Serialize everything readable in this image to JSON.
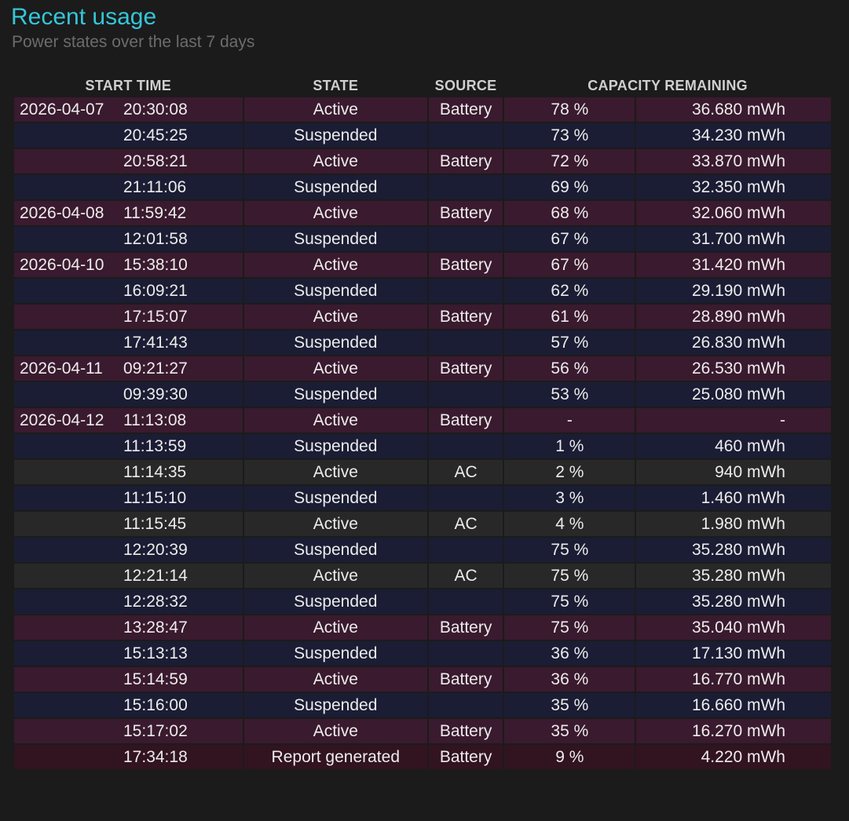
{
  "header": {
    "title": "Recent usage",
    "subtitle": "Power states over the last 7 days"
  },
  "columns": {
    "start_time": "START TIME",
    "state": "STATE",
    "source": "SOURCE",
    "capacity_remaining": "CAPACITY REMAINING"
  },
  "rows": [
    {
      "date": "2026-04-07",
      "time": "20:30:08",
      "state": "Active",
      "source": "Battery",
      "pct": "78 %",
      "mwh": "36.680 mWh",
      "kind": "battery"
    },
    {
      "date": "",
      "time": "20:45:25",
      "state": "Suspended",
      "source": "",
      "pct": "73 %",
      "mwh": "34.230 mWh",
      "kind": "suspended"
    },
    {
      "date": "",
      "time": "20:58:21",
      "state": "Active",
      "source": "Battery",
      "pct": "72 %",
      "mwh": "33.870 mWh",
      "kind": "battery"
    },
    {
      "date": "",
      "time": "21:11:06",
      "state": "Suspended",
      "source": "",
      "pct": "69 %",
      "mwh": "32.350 mWh",
      "kind": "suspended"
    },
    {
      "date": "2026-04-08",
      "time": "11:59:42",
      "state": "Active",
      "source": "Battery",
      "pct": "68 %",
      "mwh": "32.060 mWh",
      "kind": "battery"
    },
    {
      "date": "",
      "time": "12:01:58",
      "state": "Suspended",
      "source": "",
      "pct": "67 %",
      "mwh": "31.700 mWh",
      "kind": "suspended"
    },
    {
      "date": "2026-04-10",
      "time": "15:38:10",
      "state": "Active",
      "source": "Battery",
      "pct": "67 %",
      "mwh": "31.420 mWh",
      "kind": "battery"
    },
    {
      "date": "",
      "time": "16:09:21",
      "state": "Suspended",
      "source": "",
      "pct": "62 %",
      "mwh": "29.190 mWh",
      "kind": "suspended"
    },
    {
      "date": "",
      "time": "17:15:07",
      "state": "Active",
      "source": "Battery",
      "pct": "61 %",
      "mwh": "28.890 mWh",
      "kind": "battery"
    },
    {
      "date": "",
      "time": "17:41:43",
      "state": "Suspended",
      "source": "",
      "pct": "57 %",
      "mwh": "26.830 mWh",
      "kind": "suspended"
    },
    {
      "date": "2026-04-11",
      "time": "09:21:27",
      "state": "Active",
      "source": "Battery",
      "pct": "56 %",
      "mwh": "26.530 mWh",
      "kind": "battery"
    },
    {
      "date": "",
      "time": "09:39:30",
      "state": "Suspended",
      "source": "",
      "pct": "53 %",
      "mwh": "25.080 mWh",
      "kind": "suspended"
    },
    {
      "date": "2026-04-12",
      "time": "11:13:08",
      "state": "Active",
      "source": "Battery",
      "pct": "-",
      "mwh": "-",
      "kind": "battery"
    },
    {
      "date": "",
      "time": "11:13:59",
      "state": "Suspended",
      "source": "",
      "pct": "1 %",
      "mwh": "460 mWh",
      "kind": "suspended"
    },
    {
      "date": "",
      "time": "11:14:35",
      "state": "Active",
      "source": "AC",
      "pct": "2 %",
      "mwh": "940 mWh",
      "kind": "ac"
    },
    {
      "date": "",
      "time": "11:15:10",
      "state": "Suspended",
      "source": "",
      "pct": "3 %",
      "mwh": "1.460 mWh",
      "kind": "suspended"
    },
    {
      "date": "",
      "time": "11:15:45",
      "state": "Active",
      "source": "AC",
      "pct": "4 %",
      "mwh": "1.980 mWh",
      "kind": "ac"
    },
    {
      "date": "",
      "time": "12:20:39",
      "state": "Suspended",
      "source": "",
      "pct": "75 %",
      "mwh": "35.280 mWh",
      "kind": "suspended"
    },
    {
      "date": "",
      "time": "12:21:14",
      "state": "Active",
      "source": "AC",
      "pct": "75 %",
      "mwh": "35.280 mWh",
      "kind": "ac"
    },
    {
      "date": "",
      "time": "12:28:32",
      "state": "Suspended",
      "source": "",
      "pct": "75 %",
      "mwh": "35.280 mWh",
      "kind": "suspended"
    },
    {
      "date": "",
      "time": "13:28:47",
      "state": "Active",
      "source": "Battery",
      "pct": "75 %",
      "mwh": "35.040 mWh",
      "kind": "battery"
    },
    {
      "date": "",
      "time": "15:13:13",
      "state": "Suspended",
      "source": "",
      "pct": "36 %",
      "mwh": "17.130 mWh",
      "kind": "suspended"
    },
    {
      "date": "",
      "time": "15:14:59",
      "state": "Active",
      "source": "Battery",
      "pct": "36 %",
      "mwh": "16.770 mWh",
      "kind": "battery"
    },
    {
      "date": "",
      "time": "15:16:00",
      "state": "Suspended",
      "source": "",
      "pct": "35 %",
      "mwh": "16.660 mWh",
      "kind": "suspended"
    },
    {
      "date": "",
      "time": "15:17:02",
      "state": "Active",
      "source": "Battery",
      "pct": "35 %",
      "mwh": "16.270 mWh",
      "kind": "battery"
    },
    {
      "date": "",
      "time": "17:34:18",
      "state": "Report generated",
      "source": "Battery",
      "pct": "9 %",
      "mwh": "4.220 mWh",
      "kind": "report"
    }
  ],
  "colors": {
    "title": "#35c6d8",
    "battery_row": "#3a1a2e",
    "suspended_row": "#1b1d34",
    "ac_row": "#282828",
    "report_row": "#321320"
  }
}
